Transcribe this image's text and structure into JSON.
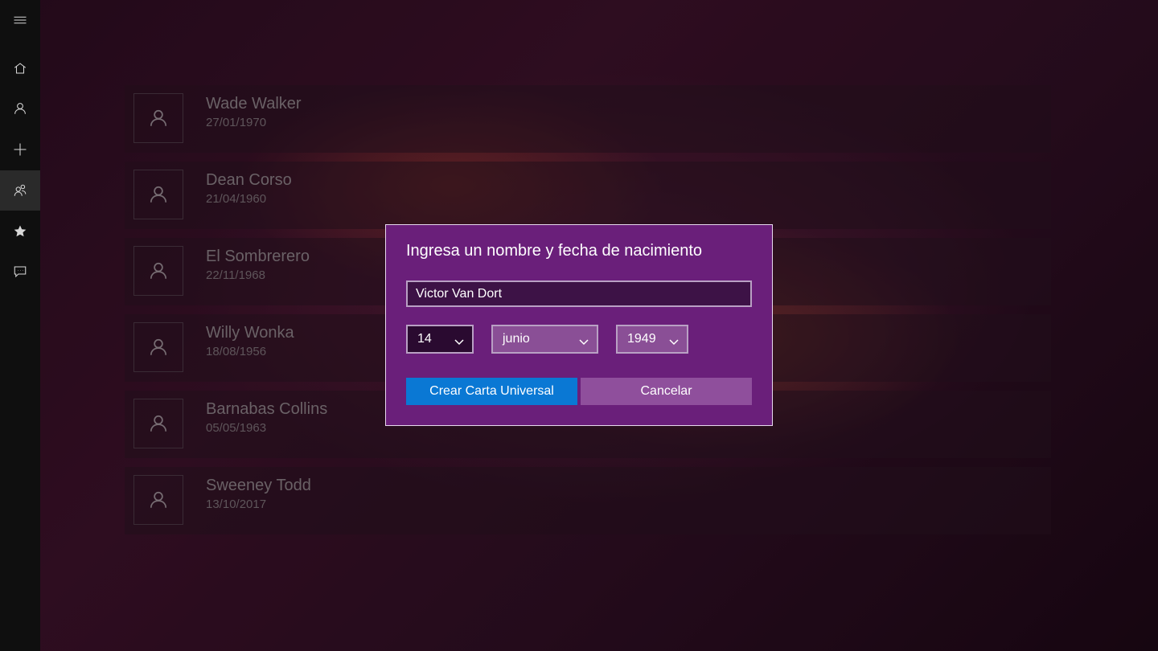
{
  "rail": {
    "items": [
      {
        "icon": "hamburger-icon"
      },
      {
        "icon": "home-icon"
      },
      {
        "icon": "person-icon"
      },
      {
        "icon": "add-icon"
      },
      {
        "icon": "people-icon",
        "active": true
      },
      {
        "icon": "star-icon"
      },
      {
        "icon": "feedback-icon"
      }
    ]
  },
  "people": [
    {
      "name": "Wade Walker",
      "date": "27/01/1970"
    },
    {
      "name": "Dean Corso",
      "date": "21/04/1960"
    },
    {
      "name": "El Sombrerero",
      "date": "22/11/1968"
    },
    {
      "name": "Willy Wonka",
      "date": "18/08/1956"
    },
    {
      "name": "Barnabas Collins",
      "date": "05/05/1963"
    },
    {
      "name": "Sweeney Todd",
      "date": "13/10/2017"
    }
  ],
  "dialog": {
    "title": "Ingresa un nombre y fecha de nacimiento",
    "name_value": "Victor Van Dort",
    "day": "14",
    "month": "junio",
    "year": "1949",
    "create_label": "Crear Carta Universal",
    "cancel_label": "Cancelar"
  },
  "colors": {
    "accent": "#0a78d4",
    "dialog_bg": "#6a1f7a"
  }
}
